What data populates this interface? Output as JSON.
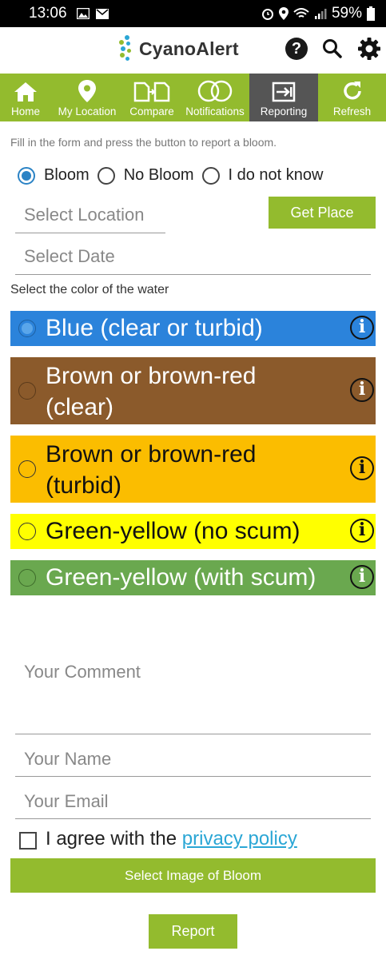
{
  "status_bar": {
    "time": "13:06",
    "battery": "59%",
    "icons": [
      "image-icon",
      "mail-icon",
      "alarm-icon",
      "location-icon",
      "wifi-icon",
      "signal-icon",
      "battery-icon"
    ]
  },
  "app": {
    "name": "CyanoAlert",
    "brand_color": "#93bb2e",
    "active_tab_color": "#555555"
  },
  "nav": {
    "tabs": [
      {
        "label": "Home",
        "icon": "home-icon"
      },
      {
        "label": "My Location",
        "icon": "location-pin-icon"
      },
      {
        "label": "Compare",
        "icon": "compare-icon"
      },
      {
        "label": "Notifications",
        "icon": "notifications-icon"
      },
      {
        "label": "Reporting",
        "icon": "reporting-icon",
        "active": true
      },
      {
        "label": "Refresh",
        "icon": "refresh-icon"
      }
    ]
  },
  "form": {
    "intro": "Fill in the form and press the button to report a bloom.",
    "bloom_options": [
      {
        "label": "Bloom",
        "selected": true
      },
      {
        "label": "No Bloom",
        "selected": false
      },
      {
        "label": "I do not know",
        "selected": false
      }
    ],
    "location_placeholder": "Select Location",
    "get_place_label": "Get Place",
    "date_placeholder": "Select Date",
    "color_section_label": "Select the color of the water",
    "colors": [
      {
        "label": "Blue (clear or turbid)",
        "bg": "#2b83db",
        "text": "#ffffff",
        "selected": true
      },
      {
        "label_lines": [
          "Brown or brown-red",
          "(clear)"
        ],
        "bg": "#8b5a2b",
        "text": "#ffffff",
        "selected": false
      },
      {
        "label_lines": [
          "Brown or brown-red",
          "(turbid)"
        ],
        "bg": "#fbbd00",
        "text": "#111111",
        "selected": false
      },
      {
        "label": "Green-yellow (no scum)",
        "bg": "#ffff00",
        "text": "#111111",
        "selected": false
      },
      {
        "label": "Green-yellow (with scum)",
        "bg": "#6aa84f",
        "text": "#ffffff",
        "selected": false
      }
    ],
    "comment_placeholder": "Your Comment",
    "name_placeholder": "Your Name",
    "email_placeholder": "Your Email",
    "agree_text": "I agree with the",
    "privacy_link": " privacy policy",
    "select_image_label": "Select Image of Bloom",
    "report_label": "Report"
  }
}
